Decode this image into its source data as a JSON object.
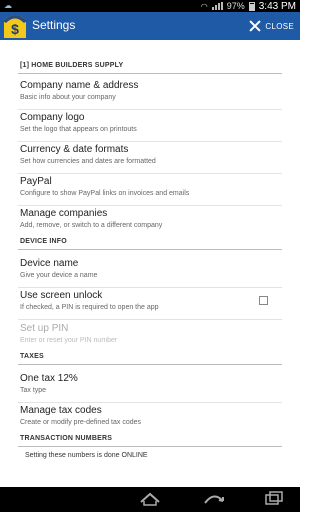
{
  "status_bar": {
    "battery": "97%",
    "time": "3:43 PM"
  },
  "app_bar": {
    "title": "Settings",
    "close_label": "CLOSE",
    "logo_symbol": "$"
  },
  "sections": {
    "home_builders": {
      "header": "[1]  HOME BUILDERS SUPPLY",
      "items": [
        {
          "title": "Company name & address",
          "subtitle": "Basic info about your company"
        },
        {
          "title": "Company logo",
          "subtitle": "Set the logo that appears on printouts"
        },
        {
          "title": "Currency & date formats",
          "subtitle": "Set how currencies and dates are formatted"
        },
        {
          "title": "PayPal",
          "subtitle": "Configure to show PayPal links on invoices and emails"
        },
        {
          "title": "Manage companies",
          "subtitle": "Add, remove, or switch to a different company"
        }
      ]
    },
    "device_info": {
      "header": "DEVICE INFO",
      "items": [
        {
          "title": "Device name",
          "subtitle": "Give your device a name"
        },
        {
          "title": "Use screen unlock",
          "subtitle": "If checked, a PIN is required to open the app",
          "checked": false
        },
        {
          "title": "Set up PIN",
          "subtitle": "Enter or reset your PIN number",
          "disabled": true
        }
      ]
    },
    "taxes": {
      "header": "TAXES",
      "items": [
        {
          "title": "One tax 12%",
          "subtitle": "Tax type"
        },
        {
          "title": "Manage tax codes",
          "subtitle": "Create or modify pre-defined tax codes"
        }
      ]
    },
    "transaction_numbers": {
      "header": "TRANSACTION NUMBERS",
      "note": "Setting these numbers is done ONLINE"
    }
  },
  "colors": {
    "action_bar": "#1f5aa6",
    "logo_yellow": "#f2c81a"
  }
}
